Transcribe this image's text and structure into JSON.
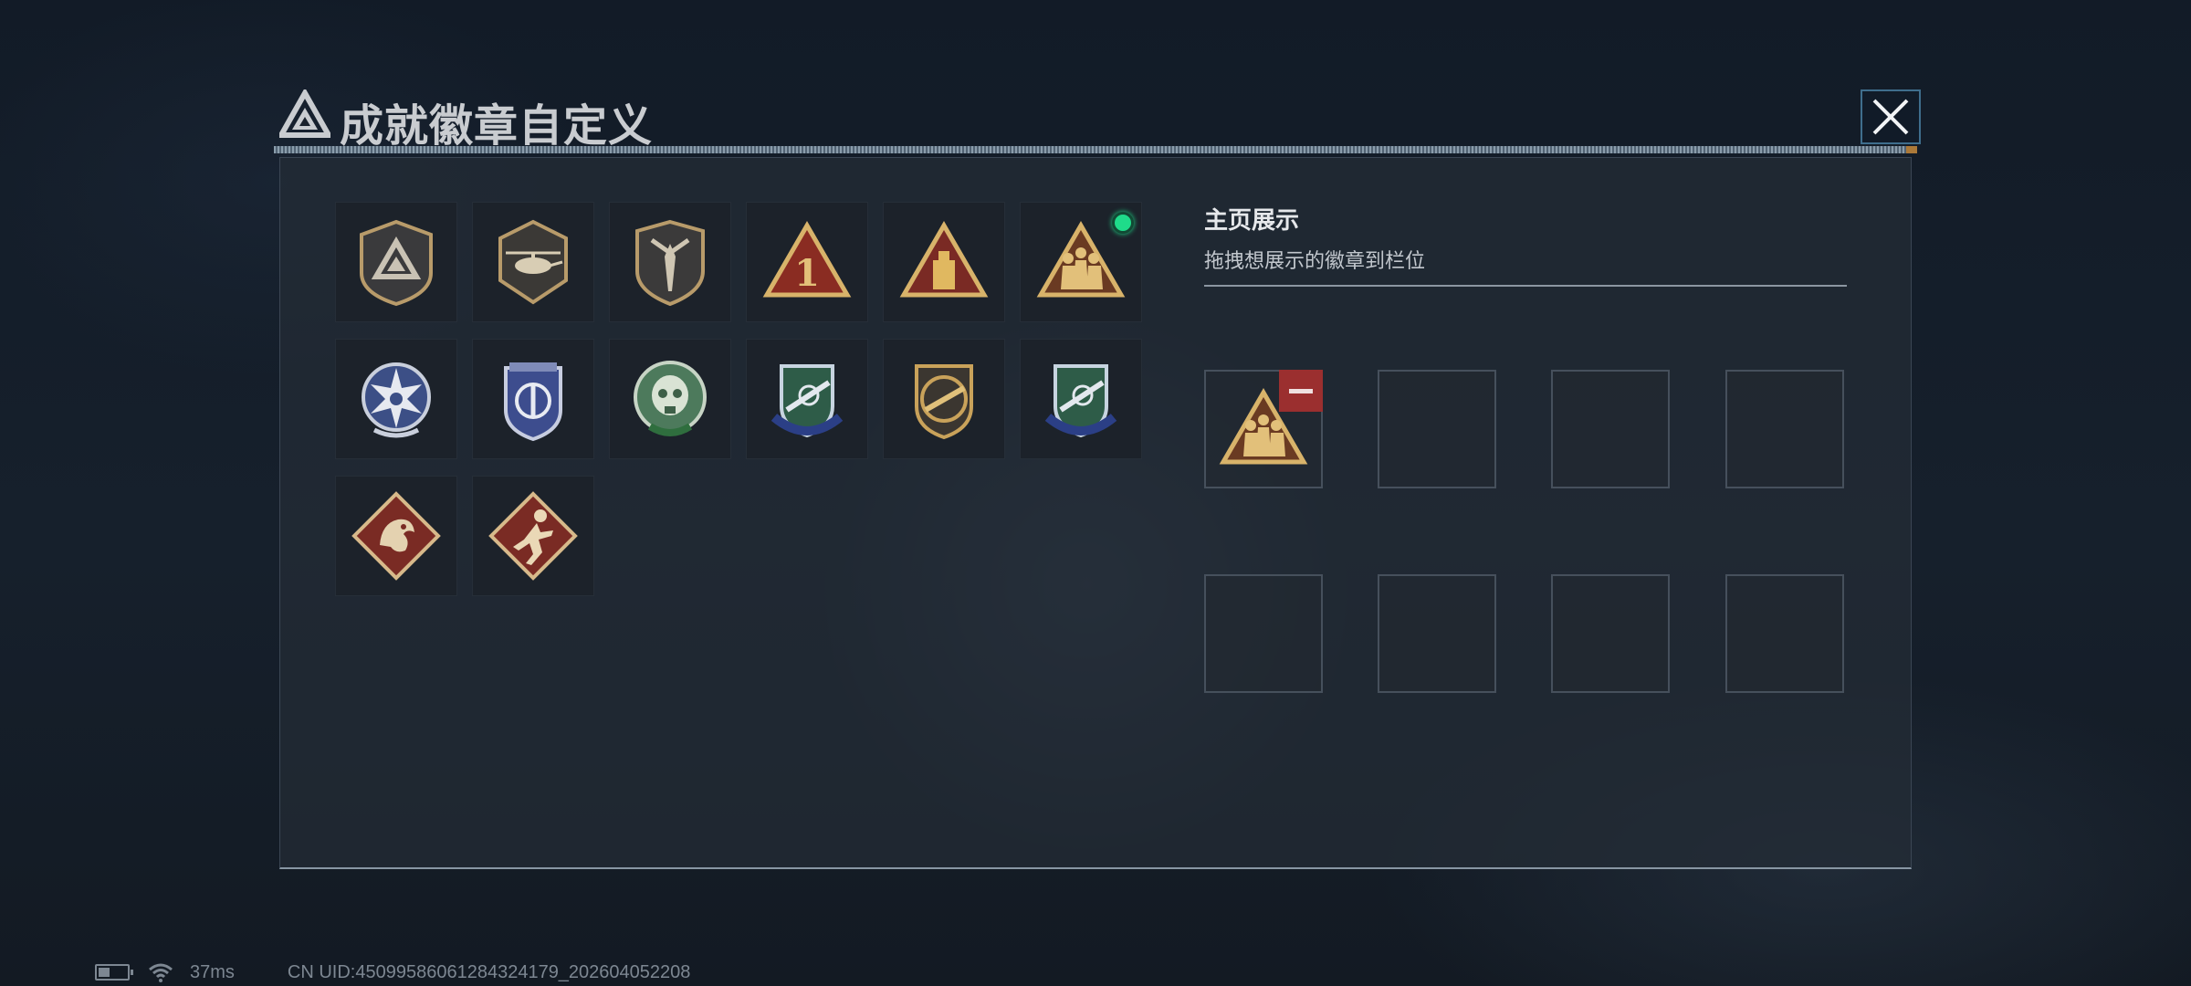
{
  "header": {
    "title": "成就徽章自定义",
    "tiny_caption": "",
    "logo_icon": "triangle-a-logo-icon",
    "close_icon": "close-icon"
  },
  "badges": [
    {
      "id": 1,
      "icon": "gray-shield-triangle-badge",
      "selected": false
    },
    {
      "id": 2,
      "icon": "helicopter-shield-badge",
      "selected": false
    },
    {
      "id": 3,
      "icon": "dagger-shield-badge",
      "selected": false
    },
    {
      "id": 4,
      "icon": "number-one-triangle-badge",
      "selected": false
    },
    {
      "id": 5,
      "icon": "ammo-triangle-badge",
      "selected": false
    },
    {
      "id": 6,
      "icon": "soldiers-triangle-badge",
      "selected": true
    },
    {
      "id": 7,
      "icon": "blue-star-badge",
      "selected": false
    },
    {
      "id": 8,
      "icon": "blue-shield-emblem-badge",
      "selected": false
    },
    {
      "id": 9,
      "icon": "green-skull-badge",
      "selected": false
    },
    {
      "id": 10,
      "icon": "sniper-rifle-shield-badge",
      "selected": false
    },
    {
      "id": 11,
      "icon": "gold-rifle-shield-badge",
      "selected": false
    },
    {
      "id": 12,
      "icon": "sniper-rifle-shield-badge-2",
      "selected": false
    },
    {
      "id": 13,
      "icon": "dragon-diamond-badge",
      "selected": false
    },
    {
      "id": 14,
      "icon": "runner-diamond-badge",
      "selected": false
    }
  ],
  "display": {
    "title": "主页展示",
    "subtitle": "拖拽想展示的徽章到栏位",
    "slots": [
      {
        "badge": "soldiers-triangle-badge",
        "filled": true
      },
      {
        "filled": false
      },
      {
        "filled": false
      },
      {
        "filled": false
      },
      {
        "filled": false
      },
      {
        "filled": false
      },
      {
        "filled": false
      },
      {
        "filled": false
      }
    ],
    "remove_icon": "minus-icon"
  },
  "status_bar": {
    "battery_icon": "battery-icon",
    "wifi_icon": "wifi-icon",
    "ping": "37ms",
    "uid": "CN UID:4509958606128432417​9_202604052208"
  },
  "colors": {
    "accent_green": "#1fdb8a",
    "remove_red": "#9b2f2f",
    "gold": "#c9a25a"
  }
}
